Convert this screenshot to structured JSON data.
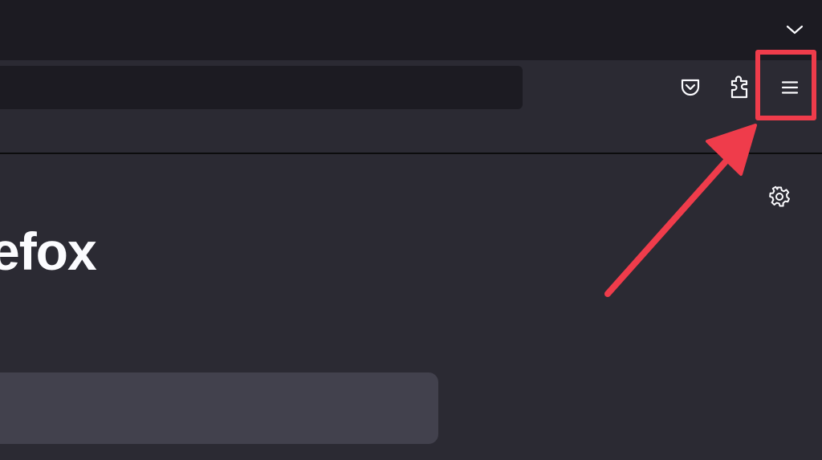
{
  "toolbar": {
    "tab_list_icon": "chevron-down-icon",
    "pocket_icon": "pocket-icon",
    "extensions_icon": "puzzle-piece-icon",
    "menu_icon": "hamburger-menu-icon"
  },
  "new_tab": {
    "brand_text": "efox",
    "settings_icon": "gear-icon"
  },
  "annotation": {
    "highlight_color": "#ef3c4b",
    "target": "menu-button"
  },
  "colors": {
    "tab_strip_bg": "#1c1b22",
    "page_bg": "#2b2a33",
    "search_bg": "#42414d",
    "text": "#fbfbfe"
  }
}
